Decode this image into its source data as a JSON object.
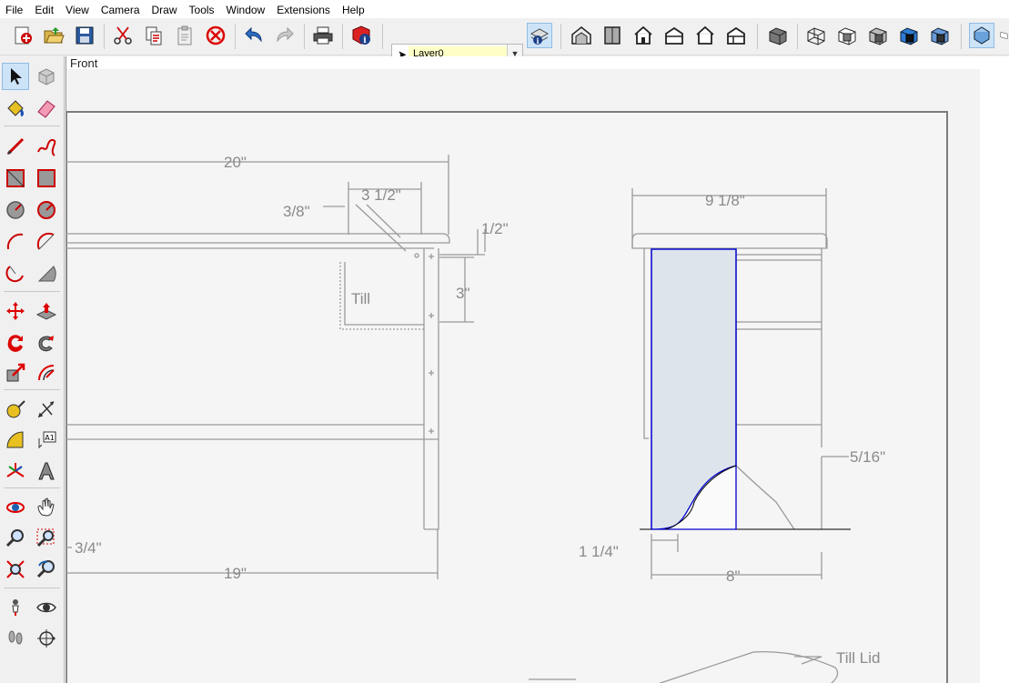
{
  "menu": [
    "File",
    "Edit",
    "View",
    "Camera",
    "Draw",
    "Tools",
    "Window",
    "Extensions",
    "Help"
  ],
  "layer": {
    "current": "Layer0"
  },
  "viewport": {
    "scene_label": "Front",
    "dims": {
      "d20": "20\"",
      "d3_1_2": "3 1/2\"",
      "d3_8": "3/8\"",
      "d1_2": "1/2\"",
      "d3": "3\"",
      "till": "Till",
      "d3_4": "3/4\"",
      "d19": "19\"",
      "d9_1_8": "9 1/8\"",
      "d5_16": "5/16\"",
      "d1_1_4": "1 1/4\"",
      "d8": "8\"",
      "till_lid": "Till Lid"
    }
  },
  "colors": {
    "selection_blue": "#0000cc",
    "selection_fill": "#dde4ec",
    "drawing_lines": "#9a9a9a",
    "toolbar_bg": "#f0f0f0"
  },
  "toolbar_icons": [
    "new-icon",
    "open-icon",
    "save-icon",
    "cut-icon",
    "copy-icon",
    "paste-icon",
    "erase-icon",
    "undo-icon",
    "redo-icon",
    "print-icon",
    "model-info-icon",
    "entity-info-icon",
    "iso-view-icon",
    "top-view-icon",
    "front-view-icon",
    "right-view-icon",
    "back-view-icon",
    "left-view-icon",
    "xray-icon",
    "wireframe-icon",
    "hidden-line-icon",
    "shaded-icon",
    "shaded-textures-icon",
    "monochrome-icon",
    "parallel-projection-icon"
  ],
  "left_tools": [
    "select-tool-icon",
    "make-component-icon",
    "paint-bucket-icon",
    "eraser-icon",
    "line-tool-icon",
    "freehand-tool-icon",
    "rectangle-tool-icon",
    "rotated-rectangle-icon",
    "circle-tool-icon",
    "polygon-tool-icon",
    "arc-tool-icon",
    "two-point-arc-icon",
    "three-point-arc-icon",
    "pie-tool-icon",
    "move-tool-icon",
    "push-pull-icon",
    "rotate-tool-icon",
    "follow-me-icon",
    "scale-tool-icon",
    "offset-tool-icon",
    "tape-measure-icon",
    "dimension-tool-icon",
    "protractor-icon",
    "text-tool-icon",
    "axes-tool-icon",
    "3d-text-icon",
    "orbit-tool-icon",
    "pan-tool-icon",
    "zoom-tool-icon",
    "zoom-window-icon",
    "zoom-extents-icon",
    "previous-view-icon",
    "position-camera-icon",
    "look-around-icon",
    "walk-tool-icon",
    "section-plane-icon"
  ]
}
